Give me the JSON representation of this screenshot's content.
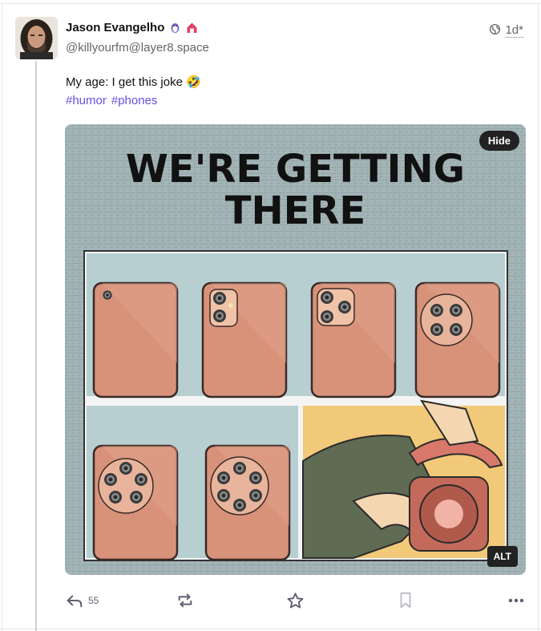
{
  "post": {
    "author": {
      "display_name": "Jason Evangelho",
      "handle": "@killyourfm@layer8.space",
      "badges": [
        "penguin-emoji",
        "house-emoji"
      ]
    },
    "visibility_icon": "globe-icon",
    "time": "1d",
    "edited_marker": "*",
    "text": "My age: I get this joke 🤣",
    "hashtags": [
      "#humor",
      "#phones"
    ],
    "media": {
      "headline_line1": "WE'RE GETTING",
      "headline_line2": "THERE",
      "hide_label": "Hide",
      "alt_label": "ALT"
    },
    "actions": {
      "reply_count": "55",
      "reply_icon": "reply-icon",
      "boost_icon": "boost-icon",
      "favourite_icon": "star-icon",
      "bookmark_icon": "bookmark-icon",
      "more_icon": "more-horizontal-icon"
    },
    "colors": {
      "hashtag": "#6a4ee0",
      "background_texture": "#9fb3b5",
      "phone": "#d8927a",
      "phone_panel": "#b7cfd0",
      "yellow_panel": "#f2c978"
    }
  }
}
